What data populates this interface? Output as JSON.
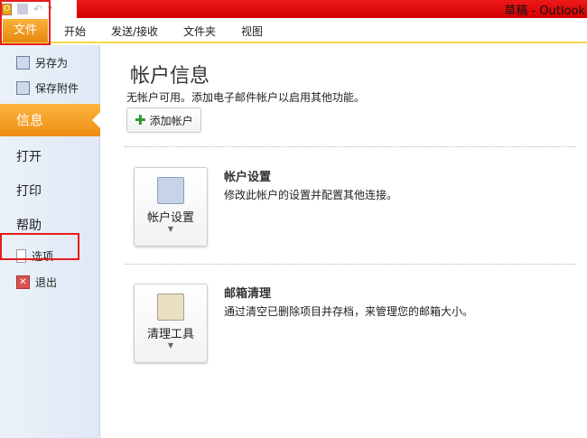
{
  "window": {
    "title": "草稿 - Outlook"
  },
  "ribbon": {
    "file": "文件",
    "tabs": [
      "开始",
      "发送/接收",
      "文件夹",
      "视图"
    ]
  },
  "sidebar": {
    "save_as": "另存为",
    "save_attachments": "保存附件",
    "info": "信息",
    "open": "打开",
    "print": "打印",
    "help": "帮助",
    "options": "选项",
    "exit": "退出"
  },
  "main": {
    "title": "帐户信息",
    "subtitle": "无帐户可用。添加电子邮件帐户以启用其他功能。",
    "add_account": "添加帐户",
    "account_settings": {
      "button": "帐户设置",
      "heading": "帐户设置",
      "desc": "修改此帐户的设置并配置其他连接。"
    },
    "cleanup": {
      "button": "清理工具",
      "heading": "邮箱清理",
      "desc": "通过清空已删除项目并存档，来管理您的邮箱大小。"
    }
  }
}
